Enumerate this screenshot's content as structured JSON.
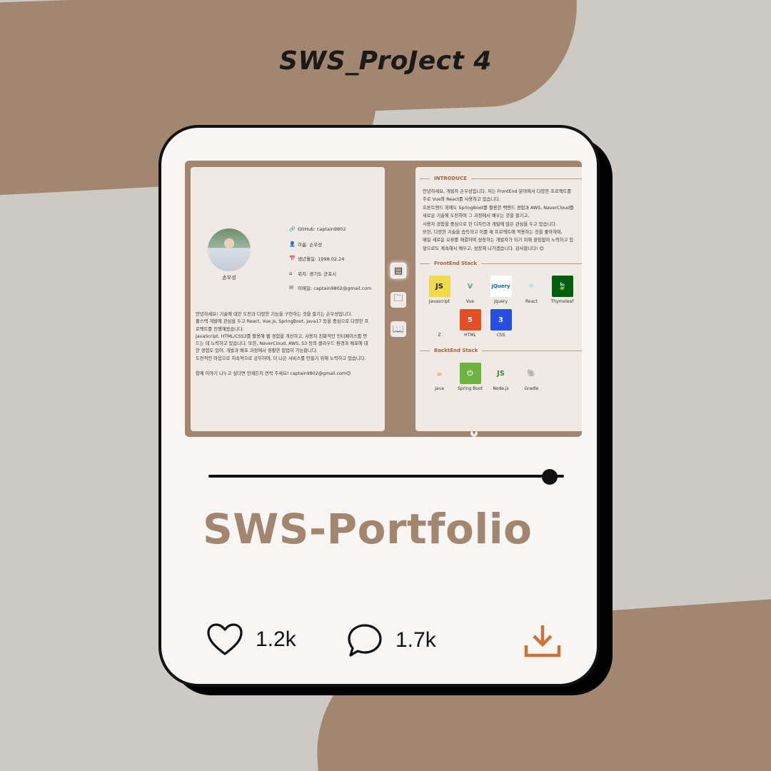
{
  "header": {
    "title": "SWS_ProJect 4"
  },
  "profile": {
    "name": "손우성",
    "info": [
      {
        "icon": "link-icon",
        "glyph": "🔗",
        "text": "GitHub: captain9802"
      },
      {
        "icon": "user-icon",
        "glyph": "👤",
        "text": "이름: 손우성"
      },
      {
        "icon": "calendar-icon",
        "glyph": "📅",
        "text": "생년월일: 1998.02.24"
      },
      {
        "icon": "home-icon",
        "glyph": "⌂",
        "text": "위치: 경기도 군포시"
      },
      {
        "icon": "mail-icon",
        "glyph": "✉",
        "text": "이메일: captain9802@gmail.com"
      }
    ],
    "intro": [
      "안녕하세요! 기술에 대한 도전과 다양한 기능을 구현하는 것을 즐기는 손우성입니다.",
      "풀스택 개발에 관심을 두고 React, Vue.js, SpringBoot, Java17 등을 중심으로 다양한 프",
      "로젝트를 진행해왔습니다.",
      "JavaScript, HTML/CSS3를 활용해 웹 경험을 개선하고, 사용자 친화적인 인터페이스를 만",
      "드는 데 노력하고 있습니다. 또한, NaverCloud, AWS, S3 등의 클라우드 환경과 배포에 대",
      "한 경험도 있어, 개발과 배포 과정에서 원활한 협업이 가능합니다.",
      "도전적인 마음으로 지속적으로 공부하며, 더 나은 서비스를 만들기 위해 노력하고 있습니다."
    ],
    "contact": "함께 이야기 나누고 싶다면 언제든지 연락 주세요! captain9802@gmail.com😊"
  },
  "side_nav": [
    {
      "name": "profile-card-icon",
      "glyph": "▤"
    },
    {
      "name": "folder-icon",
      "glyph": "🗀"
    },
    {
      "name": "book-icon",
      "glyph": "📖"
    }
  ],
  "introduce": {
    "title": "INTRODUCE",
    "lines": [
      "안녕하세요, 개발자 손우성입니다. 저는 FrontEnd 분야에서 다양한 프로젝트를",
      "주로 Vue와 React를 사용하고 있습니다.",
      "프론트엔드 외에도 SpringBoot를 활용한 백엔드 경험과 AWS, NaverCloud를",
      "새로운 기술에 도전하며 그 과정에서 배우는 것을 즐기고,",
      "사용자 경험을 중심으로 한 디자인과 개발에 많은 관심을 두고 있습니다.",
      "또한, 다양한 기술을 습득하고 이를 제 프로젝트에 적용하는 것을 좋아하며,",
      "매일 새로운 오류를 해결하며 성장하는 개발자가 되기 위해 끊임없이 노력하고 있",
      "앞으로도 계속해서 배우고, 성장해 나가겠습니다. 감사합니다! 😊"
    ]
  },
  "frontend": {
    "title": "FrontEnd Stack",
    "items": [
      {
        "label": "Javascript",
        "logo": "JS",
        "bg": "#f0db4f",
        "fg": "#222"
      },
      {
        "label": "Vue",
        "logo": "V",
        "bg": "#f1e9e4",
        "fg": "#41b883"
      },
      {
        "label": "Jquery",
        "logo": "jQuery",
        "bg": "#ffffff",
        "fg": "#0769ad"
      },
      {
        "label": "React",
        "logo": "⚛",
        "bg": "#f1e9e4",
        "fg": "#61dafb"
      },
      {
        "label": "Thymeleaf",
        "logo": "🍃",
        "bg": "#005f0f",
        "fg": "#ffffff"
      },
      {
        "label": "Z",
        "logo": "",
        "bg": "#f1e9e4",
        "fg": "#333"
      },
      {
        "label": "HTML",
        "logo": "5",
        "bg": "#e44d26",
        "fg": "#ffffff"
      },
      {
        "label": "CSS",
        "logo": "3",
        "bg": "#264de4",
        "fg": "#ffffff"
      }
    ]
  },
  "backend": {
    "title": "BacktEnd Stack",
    "items": [
      {
        "label": "Java",
        "logo": "☕",
        "bg": "#f1e9e4",
        "fg": "#e76f00"
      },
      {
        "label": "Spring Boot",
        "logo": "⏻",
        "bg": "#6db33f",
        "fg": "#ffffff"
      },
      {
        "label": "Node.js",
        "logo": "JS",
        "bg": "#f1e9e4",
        "fg": "#3c873a"
      },
      {
        "label": "Gradle",
        "logo": "🐘",
        "bg": "#f1e9e4",
        "fg": "#02303a"
      }
    ]
  },
  "progress": {
    "value": 0.96
  },
  "project": {
    "title": "SWS-Portfolio"
  },
  "stats": {
    "likes": "1.2k",
    "comments": "1.7k"
  },
  "colors": {
    "accent": "#a38670",
    "download": "#c8733a",
    "background": "#cdc9c4"
  }
}
